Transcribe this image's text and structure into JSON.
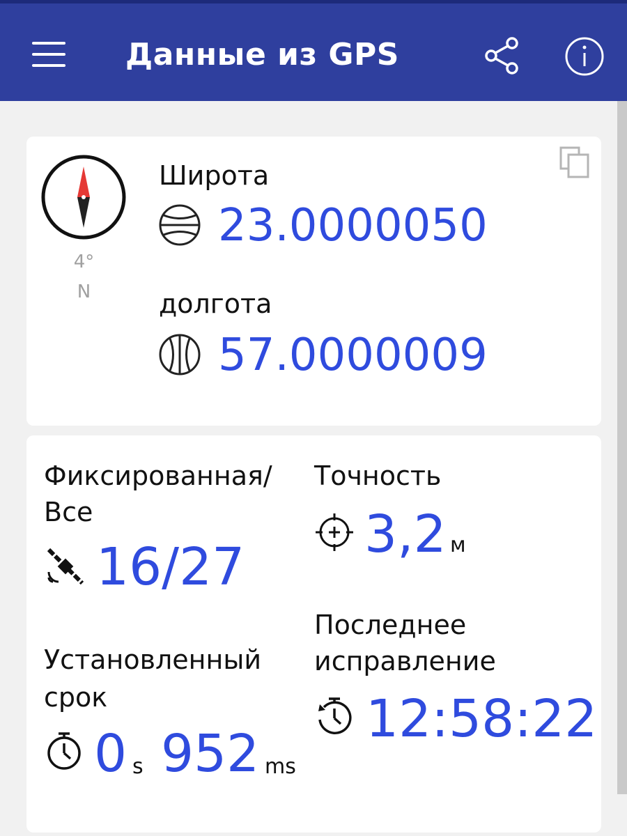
{
  "appbar": {
    "title": "Данные из GPS",
    "menu_icon": "hamburger-menu-icon",
    "share_icon": "share-icon",
    "info_icon": "info-icon",
    "background": "#2f3f9e"
  },
  "coordinates": {
    "compass": {
      "degrees": "4°",
      "direction": "N"
    },
    "latitude": {
      "label": "Широта",
      "value": "23.0000050"
    },
    "longitude": {
      "label": "долгота",
      "value": "57.0000009"
    },
    "accent_color": "#2f4bde"
  },
  "stats": {
    "satellites": {
      "label_line1": "Фиксированная/",
      "label_line2": "Все",
      "value": "16/27"
    },
    "accuracy": {
      "label": "Точность",
      "value": "3,2",
      "unit": "м"
    },
    "time_to_fix": {
      "label_line1": "Установленный",
      "label_line2": "срок",
      "seconds": "0",
      "seconds_unit": "s",
      "millis": "952",
      "millis_unit": "ms"
    },
    "last_fix": {
      "label_line1": "Последнее",
      "label_line2": "исправление",
      "value": "12:58:22"
    }
  }
}
